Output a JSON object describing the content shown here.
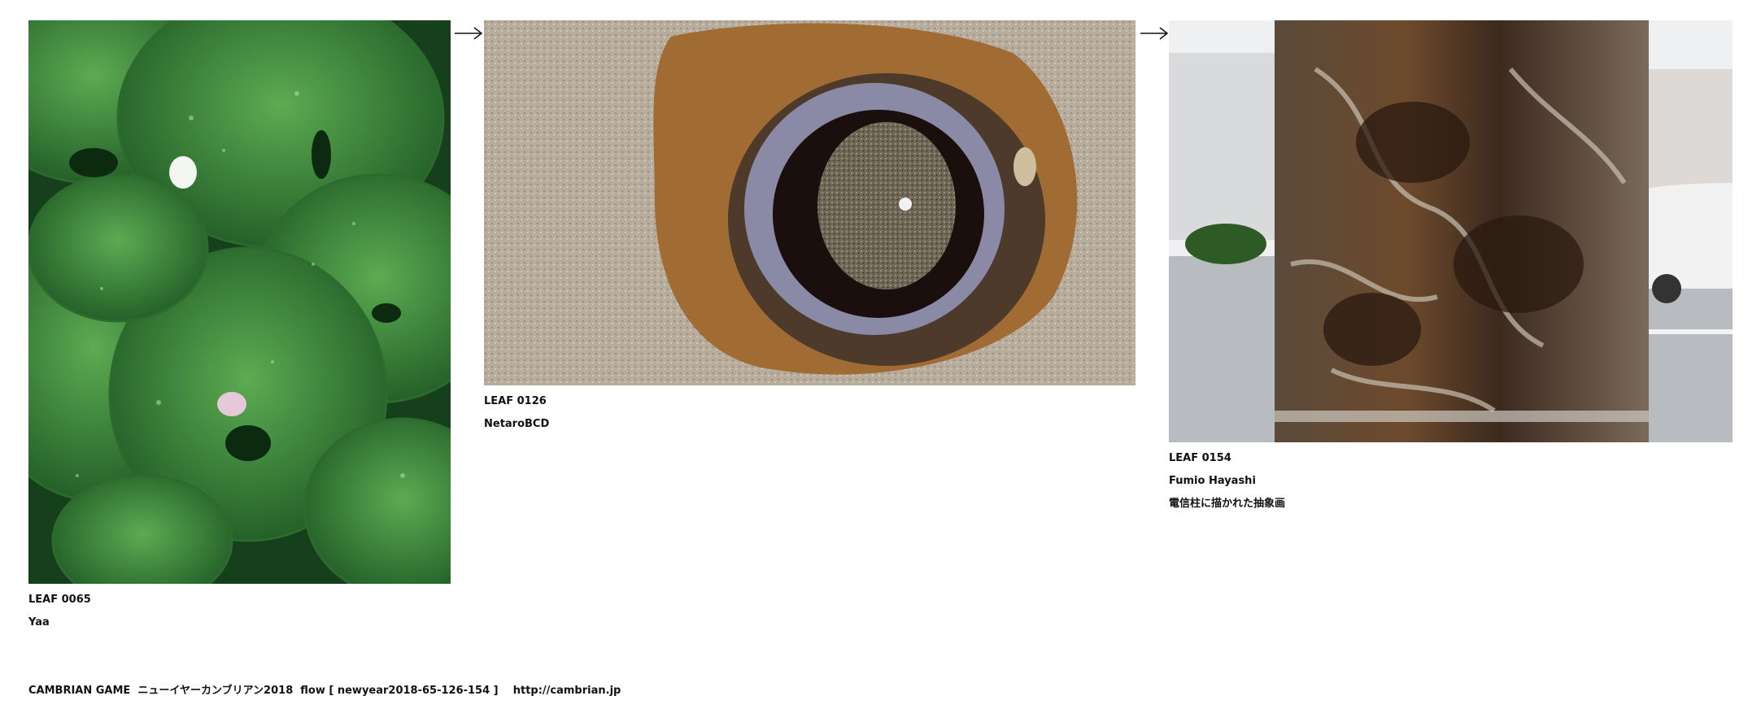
{
  "leaves": [
    {
      "code": "LEAF 0065",
      "author": "Yaa",
      "photo": "green-leaves-with-petals-photo"
    },
    {
      "code": "LEAF 0126",
      "author": "NetaroBCD",
      "photo": "sand-pit-with-water-ring-photo"
    },
    {
      "code": "LEAF 0154",
      "author": "Fumio Hayashi",
      "note": "電信柱に描かれた抽象画",
      "photo": "painted-utility-pole-photo"
    }
  ],
  "arrow_icon": "right-arrow-icon",
  "footer": {
    "text": "CAMBRIAN GAME  ニューイヤーカンブリアン2018  flow [ newyear2018-65-126-154 ]    http://cambrian.jp"
  }
}
